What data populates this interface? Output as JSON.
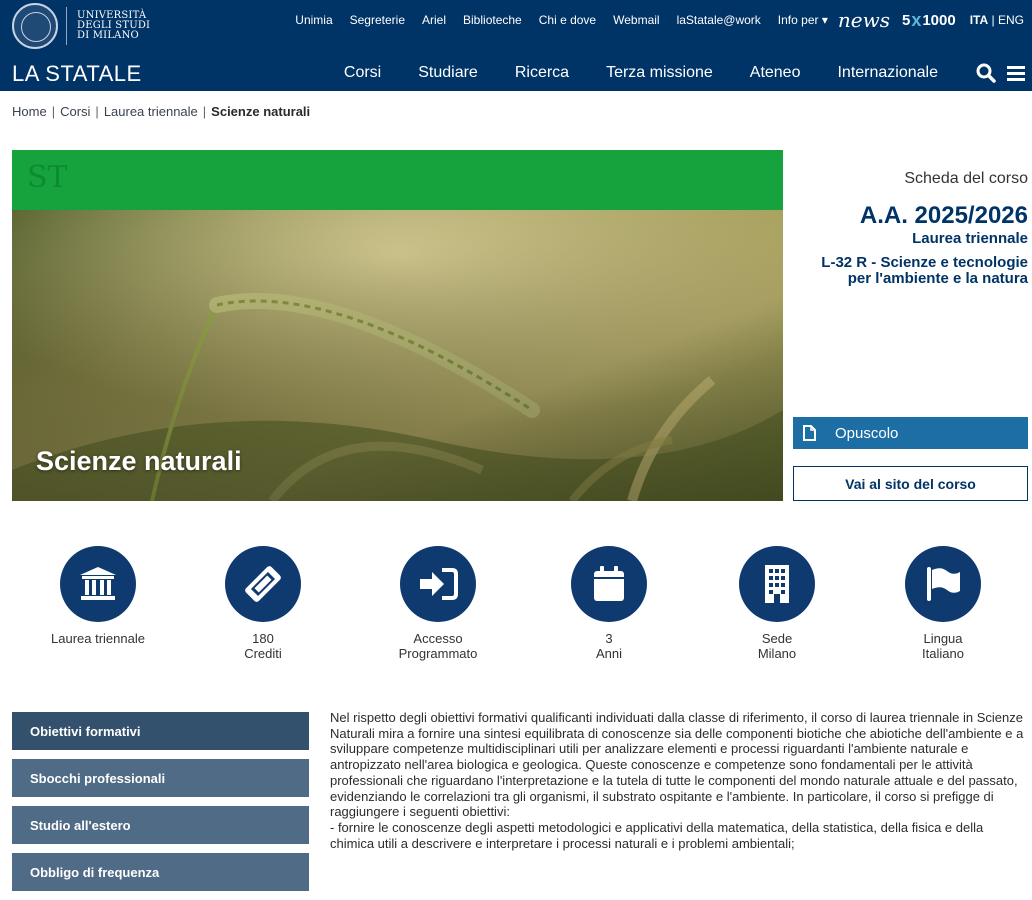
{
  "header": {
    "university_lines": [
      "UNIVERSITÀ",
      "DEGLI STUDI",
      "DI MILANO"
    ],
    "brand": "LA STATALE",
    "top_links": [
      "Unimia",
      "Segreterie",
      "Ariel",
      "Biblioteche",
      "Chi e dove",
      "Webmail",
      "laStatale@work",
      "Info per"
    ],
    "news_label": "news",
    "cinque_per_mille": {
      "left": "5",
      "x": "x",
      "right": "1000"
    },
    "lang": {
      "active": "ITA",
      "sep": "|",
      "other": "ENG"
    },
    "main_nav": [
      "Corsi",
      "Studiare",
      "Ricerca",
      "Terza missione",
      "Ateneo",
      "Internazionale"
    ],
    "icons": {
      "search": "search-icon",
      "menu": "hamburger-menu-icon",
      "dropdown": "caret-down-icon"
    }
  },
  "breadcrumb": {
    "items": [
      "Home",
      "Corsi",
      "Laurea triennale"
    ],
    "separator": "|",
    "current": "Scienze naturali"
  },
  "hero": {
    "abbr": "ST",
    "title": "Scienze naturali",
    "band_color": "#16a33e"
  },
  "course": {
    "scheda": "Scheda del corso",
    "academic_year": "A.A. 2025/2026",
    "level": "Laurea triennale",
    "class_line1": "L-32 R - Scienze e tecnologie",
    "class_line2": "per l'ambiente e la natura"
  },
  "buttons": {
    "opuscolo": "Opuscolo",
    "sito": "Vai al sito del corso"
  },
  "info": [
    {
      "icon": "university-building-icon",
      "line1": "Laurea triennale",
      "line2": ""
    },
    {
      "icon": "ticket-icon",
      "line1": "180",
      "line2": "Crediti"
    },
    {
      "icon": "enter-arrow-icon",
      "line1": "Accesso",
      "line2": "Programmato"
    },
    {
      "icon": "calendar-icon",
      "line1": "3",
      "line2": "Anni"
    },
    {
      "icon": "building-icon",
      "line1": "Sede",
      "line2": "Milano"
    },
    {
      "icon": "flag-icon",
      "line1": "Lingua",
      "line2": "Italiano"
    }
  ],
  "tabs": [
    "Obiettivi formativi",
    "Sbocchi professionali",
    "Studio all'estero",
    "Obbligo di frequenza"
  ],
  "description": "Nel rispetto degli obiettivi formativi qualificanti individuati dalla classe di riferimento, il corso di laurea triennale in Scienze Naturali mira a fornire una sintesi equilibrata di conoscenze sia delle componenti biotiche che abiotiche dell'ambiente e a sviluppare competenze multidisciplinari utili per analizzare elementi e processi riguardanti l'ambiente naturale e antropizzato nell'area biologica e geologica. Queste conoscenze e competenze sono fondamentali per le attività professionali che riguardano l'interpretazione e la tutela di tutte le componenti del mondo naturale attuale e del passato, evidenziando le correlazioni tra gli organismi, il substrato ospitante e l'ambiente. In particolare, il corso si prefigge di raggiungere i seguenti obiettivi:",
  "description_bullet": "- fornire le conoscenze degli aspetti metodologici e applicativi della matematica, della statistica, della fisica e della chimica utili a descrivere e interpretare i processi naturali e i problemi ambientali;",
  "colors": {
    "primary": "#003366",
    "accent": "#1c6ea4",
    "tab": "#4f6b85",
    "tab_active": "#33506d"
  }
}
